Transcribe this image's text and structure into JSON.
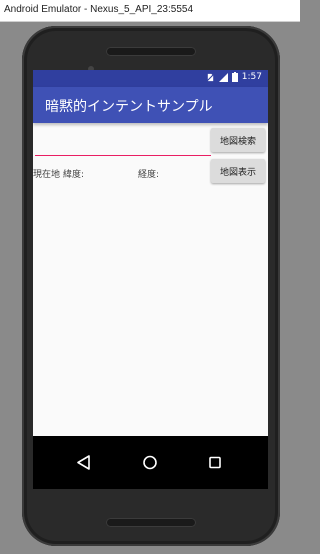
{
  "window": {
    "title": "Android Emulator - Nexus_5_API_23:5554"
  },
  "statusbar": {
    "time": "1:57",
    "icons": [
      "no-sim-icon",
      "signal-icon",
      "battery-icon"
    ]
  },
  "appbar": {
    "title": "暗黙的インテントサンプル"
  },
  "main": {
    "search_input_value": "",
    "search_button_label": "地図検索",
    "current_location_label": "現在地",
    "latitude_label": "緯度:",
    "longitude_label": "経度:",
    "show_map_button_label": "地図表示"
  },
  "navbar": {
    "icons": [
      "back-icon",
      "home-icon",
      "recents-icon"
    ]
  },
  "colors": {
    "primary": "#3f51b5",
    "primary_dark": "#303f9f",
    "accent": "#e91e63"
  }
}
